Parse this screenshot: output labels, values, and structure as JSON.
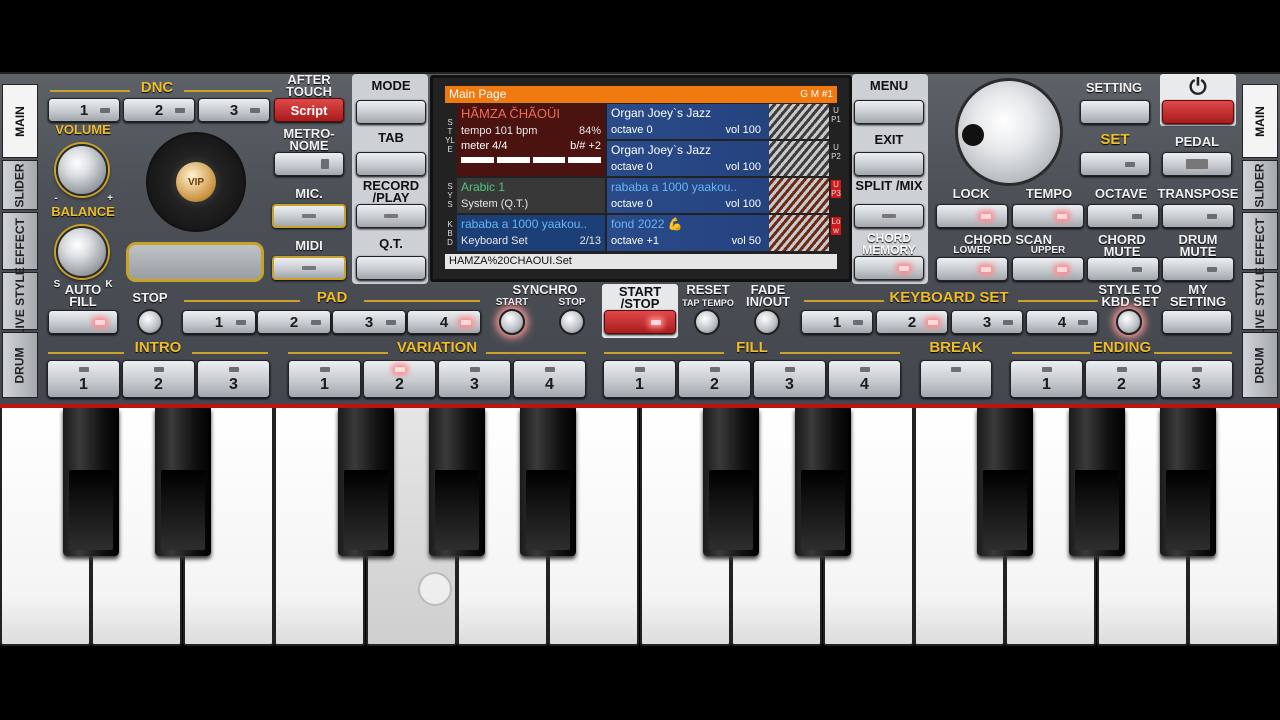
{
  "left_tabs": [
    "MAIN",
    "SLIDER",
    "EFFECT",
    "LIVE STYLE",
    "DRUM"
  ],
  "right_tabs": [
    "MAIN",
    "SLIDER",
    "EFFECT",
    "LIVE STYLE",
    "DRUM"
  ],
  "dnc": {
    "title": "DNC",
    "buttons": [
      "1",
      "2",
      "3"
    ],
    "script": "Script"
  },
  "after_touch": "AFTER TOUCH",
  "metronome": "METRO-NOME",
  "volume": "VOLUME",
  "balance": "BALANCE",
  "balance_minus": "-",
  "balance_plus": "+",
  "balance_s": "S",
  "balance_k": "K",
  "vip": "VIP",
  "mic": "MIC.",
  "midi": "MIDI",
  "mid_left": {
    "mode": "MODE",
    "tab": "TAB",
    "record": "RECORD /PLAY",
    "qt": "Q.T."
  },
  "mid_right": {
    "menu": "MENU",
    "exit": "EXIT",
    "split": "SPLIT /MIX",
    "chord_memory": "CHORD MEMORY"
  },
  "screen": {
    "header": "Main Page",
    "header_right": "G M #1",
    "style_name": "HÃMZA ČHÃOÜI",
    "tempo": "tempo 101 bpm",
    "tempo_pct": "84%",
    "meter": "meter 4/4",
    "transpose": "b/# +2",
    "system_name": "Arabic 1",
    "system_sub": "System (Q.T.)",
    "kbd_name": "rababa a 1000 yaakou..",
    "kbd_sub": "Keyboard Set",
    "kbd_count": "2/13",
    "footer": "HAMZA%20CHAOUI.Set",
    "label_style": "STYLE",
    "label_sys": "SYS",
    "label_kbd": "KBD",
    "up1": "UP1",
    "up2": "UP2",
    "up3": "UP3",
    "low": "Low",
    "voices": [
      {
        "name": "Organ Joey`s Jazz",
        "octave": "octave  0",
        "vol": "vol 100"
      },
      {
        "name": "Organ Joey`s Jazz",
        "octave": "octave  0",
        "vol": "vol 100"
      },
      {
        "name": "rababa a 1000 yaakou..",
        "octave": "octave  0",
        "vol": "vol 100"
      },
      {
        "name": "fond 2022 💪",
        "octave": "octave +1",
        "vol": "vol 50"
      }
    ]
  },
  "setting": "SETTING",
  "set": "SET",
  "pedal": "PEDAL",
  "lock": "LOCK",
  "tempo": "TEMPO",
  "octave": "OCTAVE",
  "transpose": "TRANSPOSE",
  "chord_scan": "CHORD SCAN",
  "lower": "LOWER",
  "upper": "UPPER",
  "chord_mute": "CHORD MUTE",
  "drum_mute": "DRUM MUTE",
  "auto_fill": "AUTO FILL",
  "stop": "STOP",
  "pad": {
    "title": "PAD",
    "buttons": [
      "1",
      "2",
      "3",
      "4"
    ]
  },
  "synchro": "SYNCHRO",
  "synchro_start": "START",
  "synchro_stop": "STOP",
  "start_stop": "START /STOP",
  "reset": "RESET",
  "tap_tempo": "TAP TEMPO",
  "fade": "FADE IN/OUT",
  "keyboard_set": {
    "title": "KEYBOARD SET",
    "buttons": [
      "1",
      "2",
      "3",
      "4"
    ]
  },
  "style_to_kbd": "STYLE TO KBD SET",
  "my_setting": "MY SETTING",
  "intro": {
    "title": "INTRO",
    "buttons": [
      "1",
      "2",
      "3"
    ]
  },
  "variation": {
    "title": "VARIATION",
    "buttons": [
      "1",
      "2",
      "3",
      "4"
    ]
  },
  "fill": {
    "title": "FILL",
    "buttons": [
      "1",
      "2",
      "3",
      "4"
    ]
  },
  "break": "BREAK",
  "ending": {
    "title": "ENDING",
    "buttons": [
      "1",
      "2",
      "3"
    ]
  }
}
